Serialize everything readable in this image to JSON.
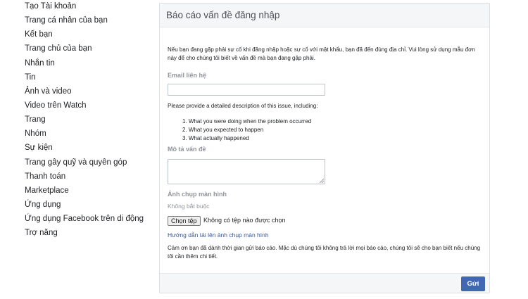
{
  "sidebar": {
    "items": [
      {
        "label": "Tạo Tài khoản"
      },
      {
        "label": "Trang cá nhân của bạn"
      },
      {
        "label": "Kết bạn"
      },
      {
        "label": "Trang chủ của bạn"
      },
      {
        "label": "Nhắn tin"
      },
      {
        "label": "Tin"
      },
      {
        "label": "Ảnh và video"
      },
      {
        "label": "Video trên Watch"
      },
      {
        "label": "Trang"
      },
      {
        "label": "Nhóm"
      },
      {
        "label": "Sự kiện"
      },
      {
        "label": "Trang gây quỹ và quyên góp"
      },
      {
        "label": "Thanh toán"
      },
      {
        "label": "Marketplace"
      },
      {
        "label": "Ứng dụng"
      },
      {
        "label": "Ứng dụng Facebook trên di động"
      },
      {
        "label": "Trợ năng"
      }
    ]
  },
  "form": {
    "title": "Báo cáo vấn đề đăng nhập",
    "intro": "Nếu bạn đang gặp phải sự cố khi đăng nhập hoặc sự cố với mật khẩu, bạn đã đến đúng địa chỉ. Vui lòng sử dụng mẫu đơn này để cho chúng tôi biết về vấn đề mà bạn đang gặp phải.",
    "email_label": "Email liên hệ",
    "email_value": "",
    "description_prompt": "Please provide a detailed description of this issue, including:",
    "steps": [
      "1. What you were doing when the problem occurred",
      "2. What you expected to happen",
      "3. What actually happened"
    ],
    "problem_label": "Mô tả vấn đề",
    "screenshot_label": "Ảnh chụp màn hình",
    "optional_label": "Không bắt buộc",
    "choose_file_label": "Chọn tệp",
    "no_file_text": "Không có tệp nào được chọn",
    "upload_help_link": "Hướng dẫn tải lên ảnh chụp màn hình",
    "thanks_text": "Cảm ơn bạn đã dành thời gian gửi báo cáo. Mặc dù chúng tôi không trả lời mọi báo cáo, chúng tôi sẽ cho bạn biết nếu chúng tôi cần thêm chi tiết.",
    "submit_label": "Gửi"
  },
  "colors": {
    "accent": "#4267b2",
    "link": "#385898",
    "muted_text": "#90949c",
    "header_bg": "#f5f6f7",
    "border": "#dddfe2"
  }
}
